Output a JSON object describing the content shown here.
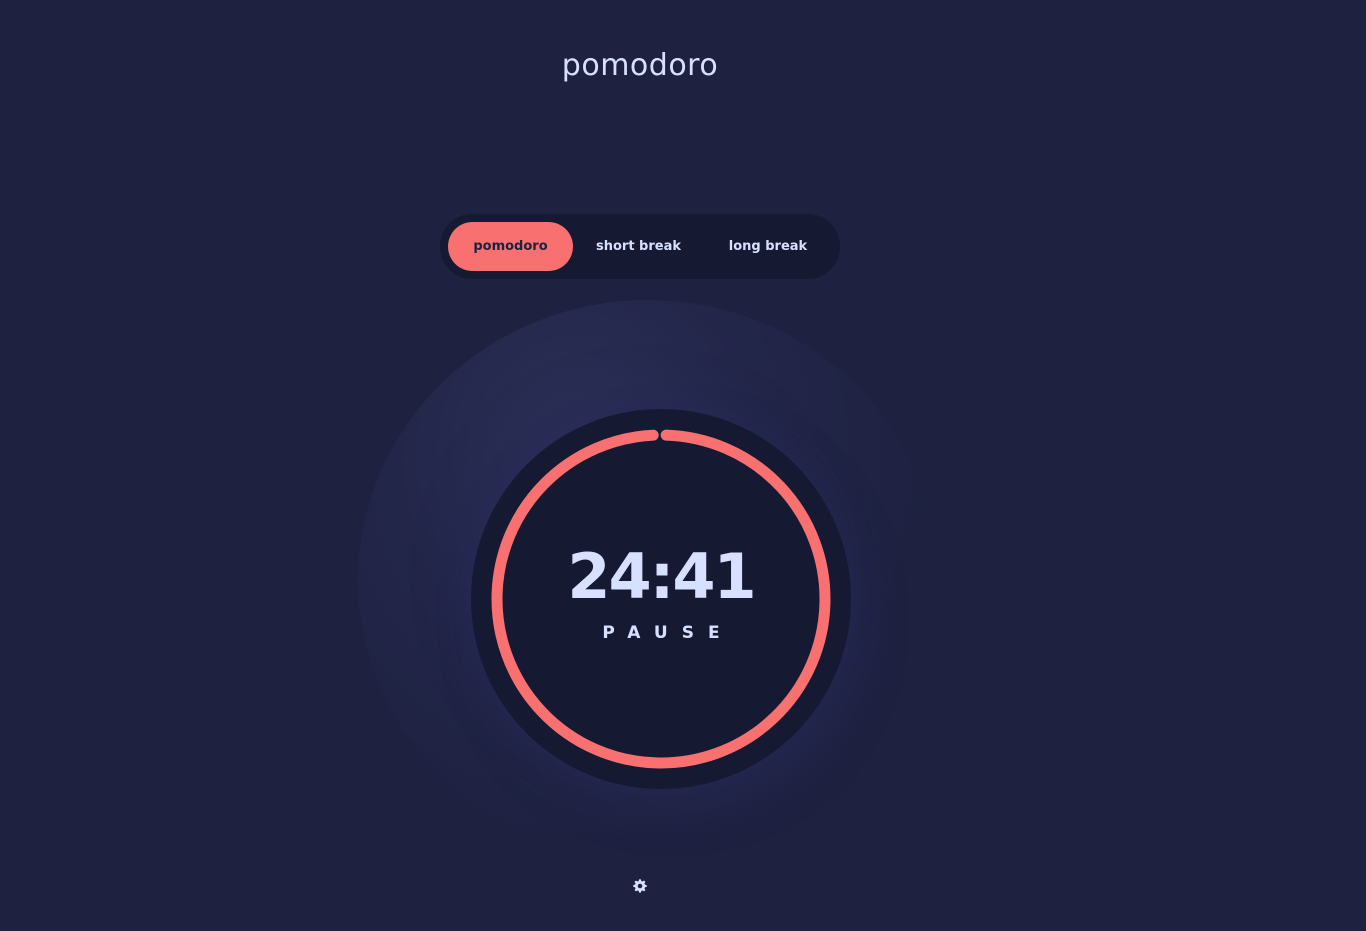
{
  "app": {
    "title": "pomodoro"
  },
  "modes": [
    {
      "label": "pomodoro",
      "active": true
    },
    {
      "label": "short break",
      "active": false
    },
    {
      "label": "long break",
      "active": false
    }
  ],
  "timer": {
    "time": "24:41",
    "action_label": "PAUSE",
    "progress": 0.987
  },
  "settings": {
    "icon": "gear-icon"
  },
  "colors": {
    "background": "#1e2140",
    "panel": "#161932",
    "accent": "#f87070",
    "text": "#d7e0ff"
  }
}
